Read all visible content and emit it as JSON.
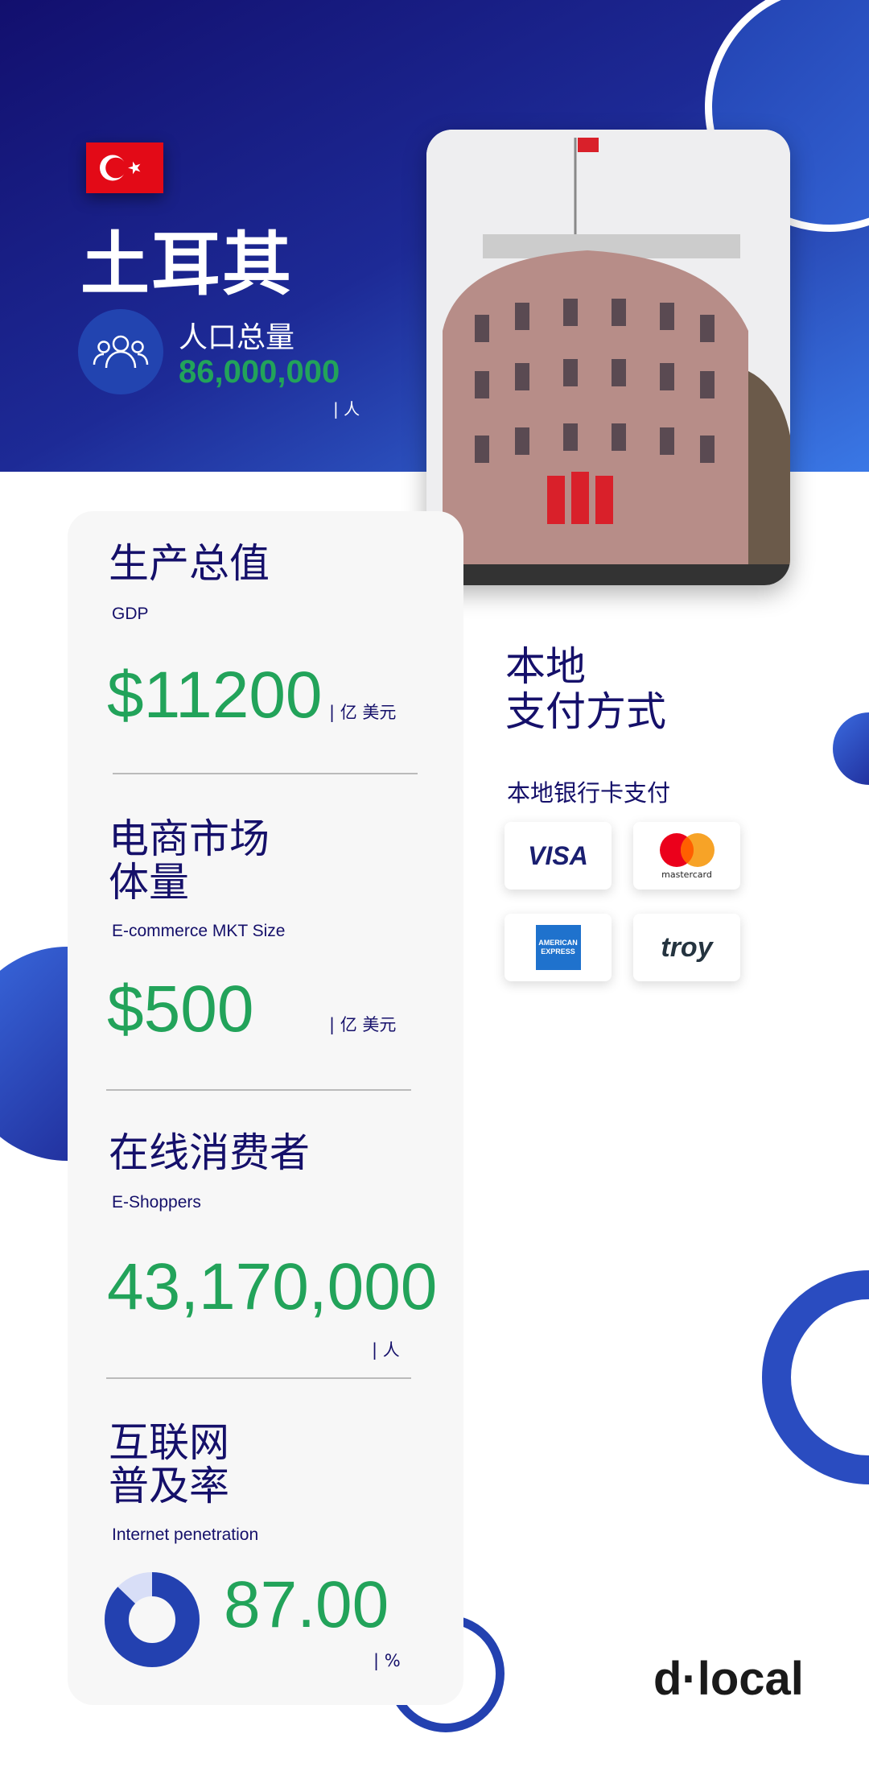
{
  "country": {
    "name": "土耳其",
    "flag": "turkey-flag"
  },
  "population": {
    "label": "人口总量",
    "value": "86,000,000",
    "unit": "| 人",
    "icon": "people-icon"
  },
  "stats": [
    {
      "title": "生产总值",
      "subtitle": "GDP",
      "value": "$11200",
      "unit": "| 亿 美元"
    },
    {
      "title": "电商市场\n体量",
      "subtitle": "E-commerce MKT Size",
      "value": "$500",
      "unit": "| 亿 美元"
    },
    {
      "title": "在线消费者",
      "subtitle": "E-Shoppers",
      "value": "43,170,000",
      "unit": "| 人"
    },
    {
      "title": "互联网\n普及率",
      "subtitle": "Internet penetration",
      "value": "87.00",
      "unit": "| %",
      "percent": 87
    }
  ],
  "payments": {
    "title": "本地\n支付方式",
    "subtitle": "本地银行卡支付",
    "methods": [
      "VISA",
      "mastercard",
      "AMERICAN EXPRESS",
      "troy"
    ]
  },
  "brand": {
    "logo": "d·local"
  },
  "colors": {
    "navy": "#15106a",
    "green": "#22a35a",
    "blue": "#2341b0"
  }
}
